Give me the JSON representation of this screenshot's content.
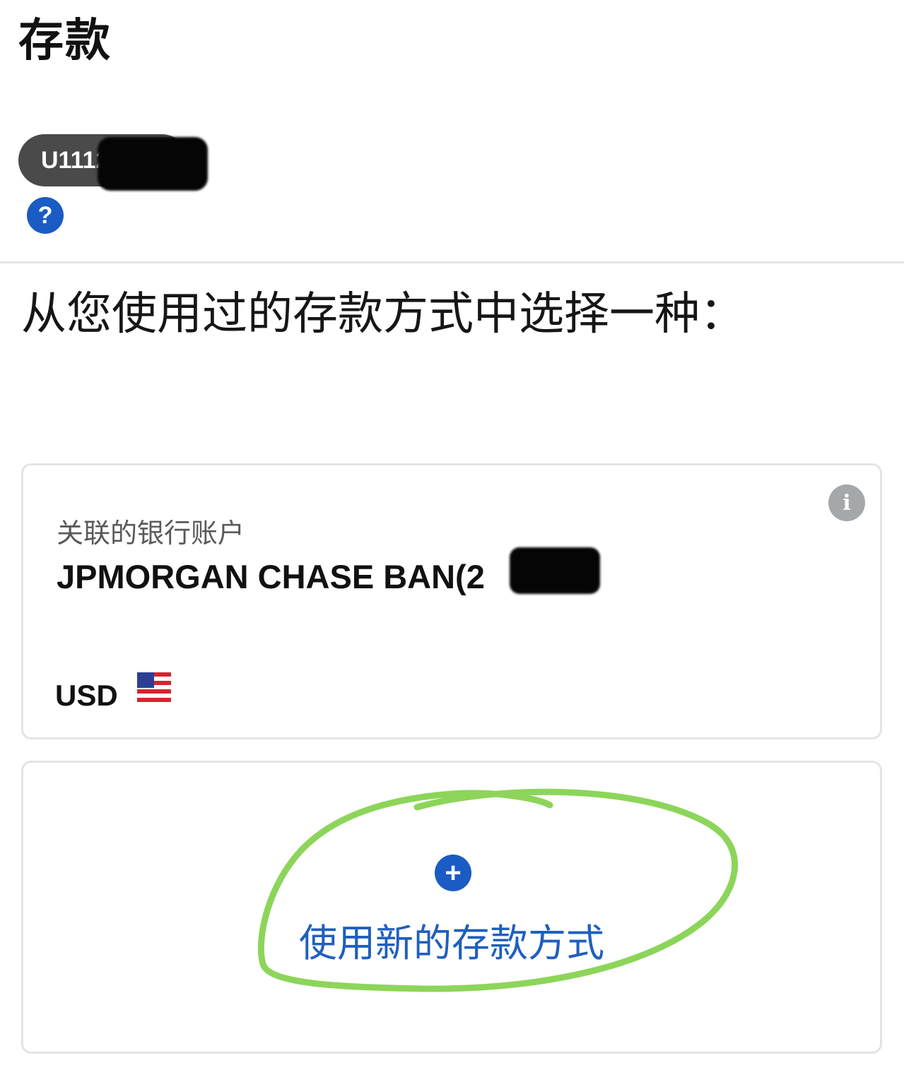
{
  "page": {
    "title": "存款"
  },
  "account": {
    "id_visible": "U1112"
  },
  "help": {
    "icon_glyph": "?"
  },
  "section": {
    "title": "从您使用过的存款方式中选择一种："
  },
  "saved_method": {
    "type_label": "关联的银行账户",
    "bank_name": "JPMORGAN CHASE BAN(2",
    "currency": "USD",
    "info_glyph": "i",
    "flag_icon": "us-flag-icon"
  },
  "new_method": {
    "icon_glyph": "+",
    "label": "使用新的存款方式"
  },
  "colors": {
    "accent_blue": "#1a5cc4",
    "highlight_green": "#8cd55a"
  }
}
